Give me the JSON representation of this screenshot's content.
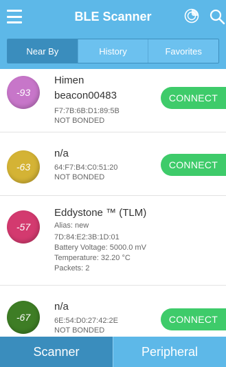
{
  "app": {
    "title": "BLE Scanner"
  },
  "tabs": [
    {
      "label": "Near By",
      "active": true
    },
    {
      "label": "History",
      "active": false
    },
    {
      "label": "Favorites",
      "active": false
    }
  ],
  "devices": [
    {
      "rssi": "-93",
      "color": "#c776c9",
      "name_lines": [
        "Himen",
        "beacon00483"
      ],
      "details": [
        "F7:7B:6B:D1:89:5B",
        "NOT BONDED"
      ],
      "action": "CONNECT"
    },
    {
      "rssi": "-63",
      "color": "#d4b335",
      "name_lines": [
        "n/a"
      ],
      "details": [
        "64:F7:B4:C0:51:20",
        "NOT BONDED"
      ],
      "action": "CONNECT"
    },
    {
      "rssi": "-57",
      "color": "#d33a6f",
      "name_lines": [
        "Eddystone ™ (TLM)"
      ],
      "details": [
        "Alias: new",
        "7D:84:E2:3B:1D:01",
        "Battery Voltage: 5000.0 mV",
        "Temperature: 32.20 °C",
        "Packets: 2"
      ],
      "action": null
    },
    {
      "rssi": "-67",
      "color": "#3e7d25",
      "name_lines": [
        "n/a"
      ],
      "details": [
        "6E:54:D0:27:42:2E",
        "NOT BONDED"
      ],
      "action": "CONNECT"
    }
  ],
  "bottom_tabs": [
    {
      "label": "Scanner",
      "active": true
    },
    {
      "label": "Peripheral",
      "active": false
    }
  ],
  "icons": {
    "menu": "hamburger-menu-icon",
    "radar": "radar-icon",
    "search": "search-icon"
  },
  "colors": {
    "primary": "#5db8e8",
    "primary_dark": "#3a8dbd",
    "connect": "#3ecb6a"
  }
}
